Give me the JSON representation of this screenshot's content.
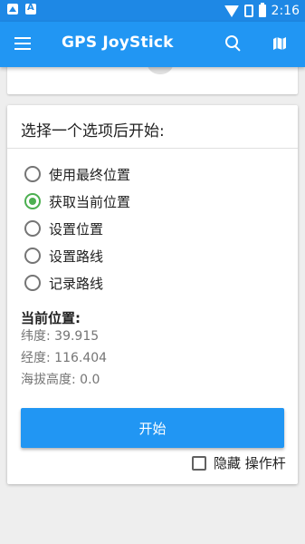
{
  "status_bar": {
    "time": "2:16",
    "icons": [
      "image-notification-icon",
      "text-notification-icon",
      "wifi-icon",
      "no-sim-icon",
      "battery-icon"
    ]
  },
  "app_bar": {
    "title": "GPS JoyStick",
    "background": "#2196f3",
    "icons": [
      "menu-icon",
      "search-icon",
      "map-icon"
    ]
  },
  "main_card": {
    "header": "选择一个选项后开始:",
    "options": [
      {
        "label": "使用最终位置",
        "selected": false
      },
      {
        "label": "获取当前位置",
        "selected": true
      },
      {
        "label": "设置位置",
        "selected": false
      },
      {
        "label": "设置路线",
        "selected": false
      },
      {
        "label": "记录路线",
        "selected": false
      }
    ],
    "current_position": {
      "title": "当前位置:",
      "latitude": "纬度: 39.915",
      "longitude": "经度: 116.404",
      "altitude": "海拔高度: 0.0"
    },
    "start_button": "开始",
    "hide_joystick": {
      "label": "隐藏 操作杆",
      "checked": false
    }
  },
  "colors": {
    "accent": "#2196f3",
    "status_bar": "#1e88e5",
    "radio_selected": "#4caf50"
  }
}
